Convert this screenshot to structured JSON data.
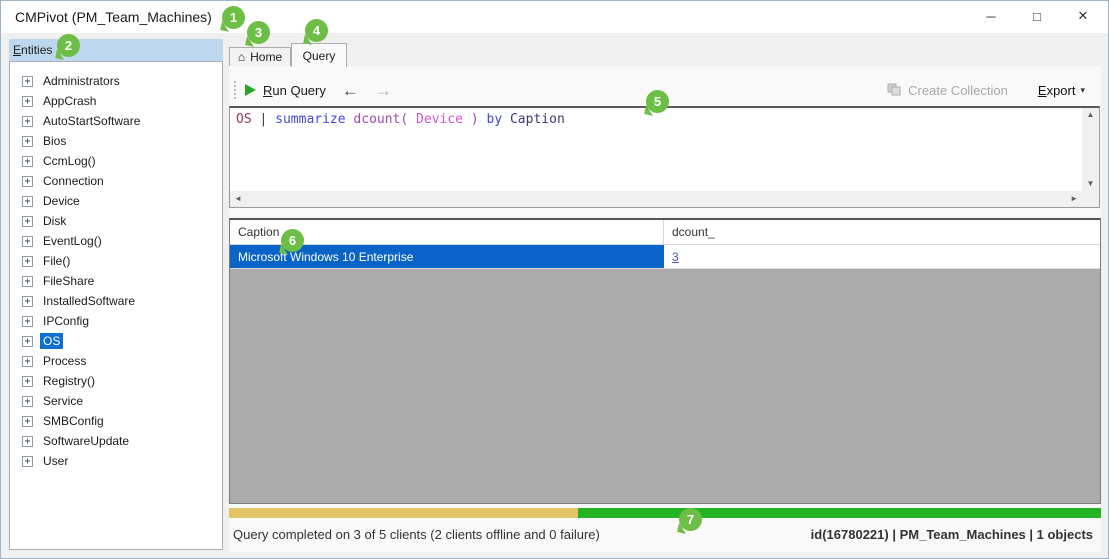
{
  "window": {
    "title": "CMPivot (PM_Team_Machines)",
    "controls": {
      "minimize": "─",
      "maximize": "□",
      "close": "✕"
    }
  },
  "sidebar": {
    "header": "Entities",
    "items": [
      {
        "label": "Administrators",
        "selected": false
      },
      {
        "label": "AppCrash",
        "selected": false
      },
      {
        "label": "AutoStartSoftware",
        "selected": false
      },
      {
        "label": "Bios",
        "selected": false
      },
      {
        "label": "CcmLog()",
        "selected": false
      },
      {
        "label": "Connection",
        "selected": false
      },
      {
        "label": "Device",
        "selected": false
      },
      {
        "label": "Disk",
        "selected": false
      },
      {
        "label": "EventLog()",
        "selected": false
      },
      {
        "label": "File()",
        "selected": false
      },
      {
        "label": "FileShare",
        "selected": false
      },
      {
        "label": "InstalledSoftware",
        "selected": false
      },
      {
        "label": "IPConfig",
        "selected": false
      },
      {
        "label": "OS",
        "selected": true
      },
      {
        "label": "Process",
        "selected": false
      },
      {
        "label": "Registry()",
        "selected": false
      },
      {
        "label": "Service",
        "selected": false
      },
      {
        "label": "SMBConfig",
        "selected": false
      },
      {
        "label": "SoftwareUpdate",
        "selected": false
      },
      {
        "label": "User",
        "selected": false
      }
    ]
  },
  "tabs": {
    "home": "Home",
    "query": "Query"
  },
  "icons": {
    "home_glyph": "⌂",
    "expand_glyph": "+",
    "export_caret": "▾",
    "scroll_up": "▲",
    "scroll_down": "▼",
    "scroll_left": "◄",
    "scroll_right": "►",
    "nav_back": "←",
    "nav_forward": "→"
  },
  "toolbar": {
    "run_query": "Run Query",
    "create_collection": "Create Collection",
    "export": "Export"
  },
  "query_editor": {
    "text": "OS | summarize dcount( Device ) by Caption",
    "tokens": [
      {
        "text": "OS",
        "color": "#9e3a55"
      },
      {
        "text": " | ",
        "color": "#3c3c3c"
      },
      {
        "text": "summarize",
        "color": "#4646d8"
      },
      {
        "text": " ",
        "color": "#3c3c3c"
      },
      {
        "text": "dcount(",
        "color": "#a04bb5"
      },
      {
        "text": " ",
        "color": "#3c3c3c"
      },
      {
        "text": "Device",
        "color": "#c85ac8"
      },
      {
        "text": " ",
        "color": "#3c3c3c"
      },
      {
        "text": ")",
        "color": "#a04bb5"
      },
      {
        "text": " ",
        "color": "#3c3c3c"
      },
      {
        "text": "by",
        "color": "#4646d8"
      },
      {
        "text": " ",
        "color": "#3c3c3c"
      },
      {
        "text": "Caption",
        "color": "#3a3a70"
      }
    ]
  },
  "results": {
    "columns": [
      "Caption",
      "dcount_"
    ],
    "rows": [
      {
        "caption": "Microsoft Windows 10 Enterprise",
        "dcount": "3",
        "selected": true
      }
    ]
  },
  "status": {
    "progress_segments": [
      {
        "color": "#e4c566",
        "pct": 40
      },
      {
        "color": "#24b324",
        "pct": 60
      }
    ],
    "left": "Query completed on 3 of 5 clients (2 clients offline and 0 failure)",
    "right": "id(16780221)  |  PM_Team_Machines  |  1 objects"
  },
  "callouts": [
    "1",
    "2",
    "3",
    "4",
    "5",
    "6",
    "7"
  ],
  "colors": {
    "badge_green": "#6dbe45",
    "entities_header_blue": "#bdd7ee",
    "tree_selection_blue": "#0f6fd0",
    "row_selection_blue": "#0a64c8",
    "link_blue": "#4a55cc",
    "progress_gold": "#e4c566",
    "progress_green": "#24b324",
    "run_play_green": "#2da52d"
  }
}
